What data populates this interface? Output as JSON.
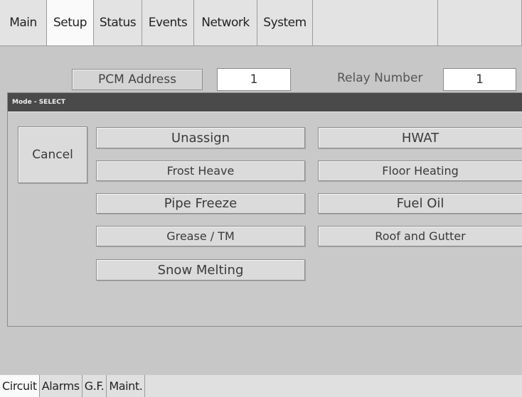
{
  "top_tabs": [
    {
      "label": "Main"
    },
    {
      "label": "Setup"
    },
    {
      "label": "Status"
    },
    {
      "label": "Events"
    },
    {
      "label": "Network"
    },
    {
      "label": "System"
    }
  ],
  "header": {
    "pcm_address_label": "PCM Address",
    "pcm_address_value": "1",
    "relay_number_label": "Relay Number",
    "relay_number_value": "1"
  },
  "dialog": {
    "title": "Mode - SELECT",
    "cancel_label": "Cancel",
    "options_left": [
      "Unassign",
      "Frost Heave",
      "Pipe Freeze",
      "Grease / TM",
      "Snow Melting"
    ],
    "options_right": [
      "HWAT",
      "Floor Heating",
      "Fuel Oil",
      "Roof and Gutter"
    ]
  },
  "bottom_tabs": [
    {
      "label": "Circuit"
    },
    {
      "label": "Alarms"
    },
    {
      "label": "G.F."
    },
    {
      "label": "Maint."
    }
  ],
  "colors": {
    "background": "#c7c7c7",
    "title_bar": "#4a4a4a",
    "active_tab": "#fafafa"
  }
}
